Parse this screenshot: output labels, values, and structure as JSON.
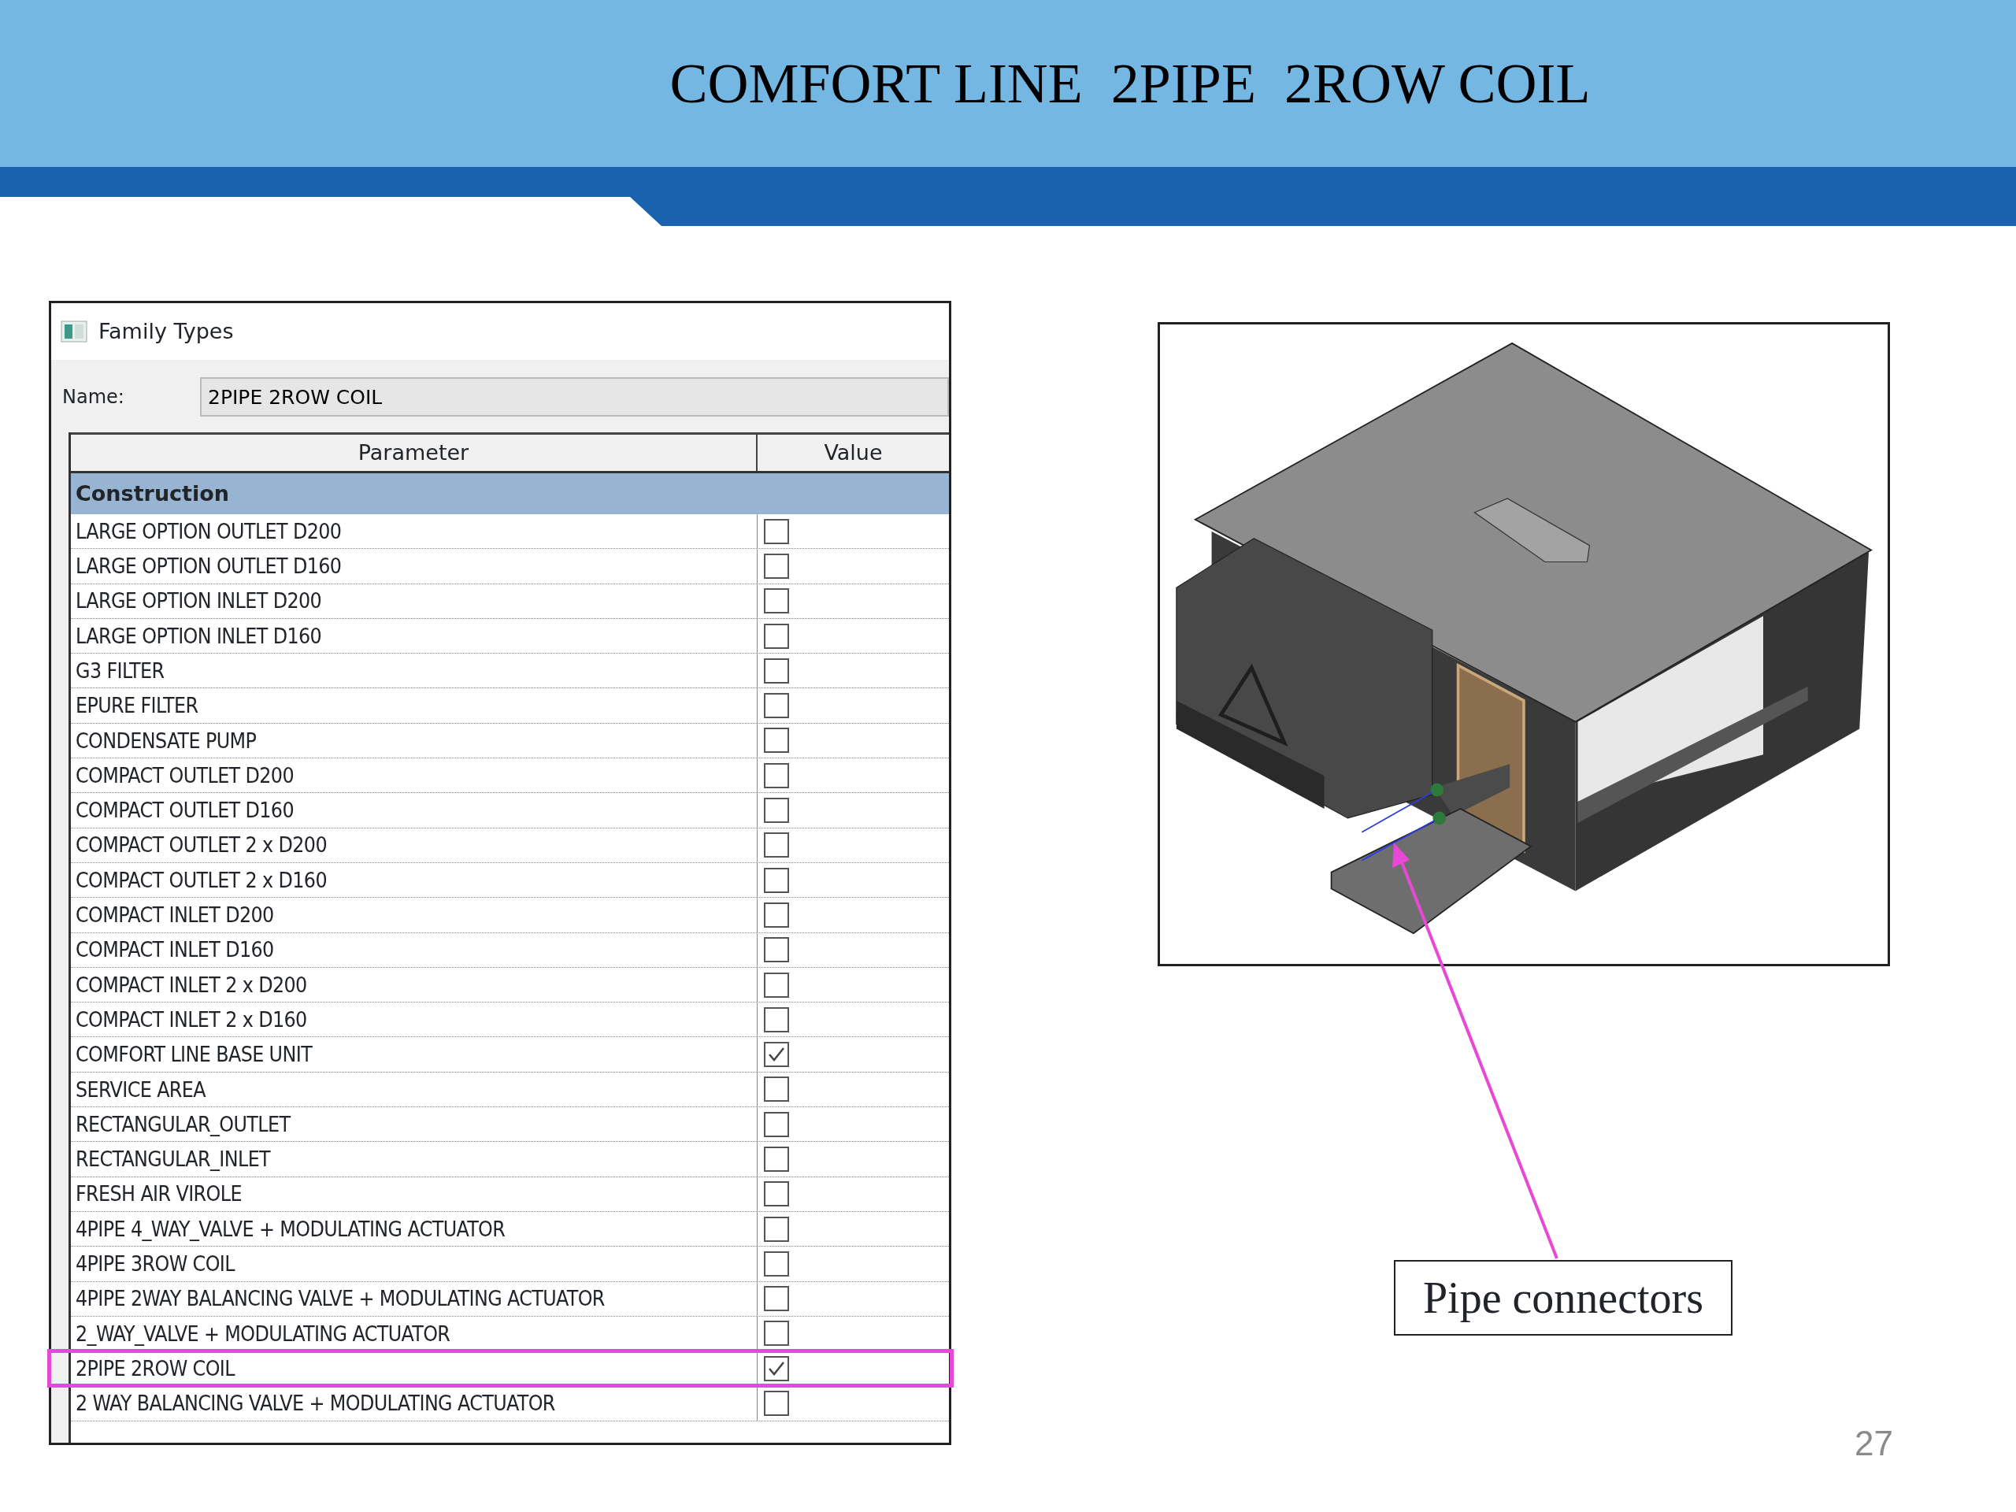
{
  "slide": {
    "title": "COMFORT LINE  2PIPE  2ROW COIL",
    "page_number": "27"
  },
  "dialog": {
    "title": "Family Types",
    "name_label": "Name:",
    "name_value": "2PIPE 2ROW COIL",
    "table": {
      "columns": [
        "Parameter",
        "Value"
      ],
      "group": "Construction",
      "rows": [
        {
          "label": "LARGE OPTION OUTLET D200",
          "checked": false,
          "highlighted": false
        },
        {
          "label": "LARGE OPTION OUTLET D160",
          "checked": false,
          "highlighted": false
        },
        {
          "label": "LARGE OPTION INLET D200",
          "checked": false,
          "highlighted": false
        },
        {
          "label": "LARGE OPTION INLET D160",
          "checked": false,
          "highlighted": false
        },
        {
          "label": "G3 FILTER",
          "checked": false,
          "highlighted": false
        },
        {
          "label": "EPURE FILTER",
          "checked": false,
          "highlighted": false
        },
        {
          "label": "CONDENSATE PUMP",
          "checked": false,
          "highlighted": false
        },
        {
          "label": "COMPACT OUTLET D200",
          "checked": false,
          "highlighted": false
        },
        {
          "label": "COMPACT OUTLET D160",
          "checked": false,
          "highlighted": false
        },
        {
          "label": "COMPACT OUTLET 2 x D200",
          "checked": false,
          "highlighted": false
        },
        {
          "label": "COMPACT OUTLET 2 x D160",
          "checked": false,
          "highlighted": false
        },
        {
          "label": "COMPACT INLET D200",
          "checked": false,
          "highlighted": false
        },
        {
          "label": "COMPACT INLET D160",
          "checked": false,
          "highlighted": false
        },
        {
          "label": "COMPACT INLET 2 x D200",
          "checked": false,
          "highlighted": false
        },
        {
          "label": "COMPACT INLET 2 x D160",
          "checked": false,
          "highlighted": false
        },
        {
          "label": "COMFORT LINE BASE UNIT",
          "checked": true,
          "highlighted": false
        },
        {
          "label": "SERVICE AREA",
          "checked": false,
          "highlighted": false
        },
        {
          "label": "RECTANGULAR_OUTLET",
          "checked": false,
          "highlighted": false
        },
        {
          "label": "RECTANGULAR_INLET",
          "checked": false,
          "highlighted": false
        },
        {
          "label": "FRESH AIR VIROLE",
          "checked": false,
          "highlighted": false
        },
        {
          "label": "4PIPE 4_WAY_VALVE + MODULATING ACTUATOR",
          "checked": false,
          "highlighted": false
        },
        {
          "label": "4PIPE 3ROW  COIL",
          "checked": false,
          "highlighted": false
        },
        {
          "label": "4PIPE 2WAY BALANCING VALVE + MODULATING ACTUATOR",
          "checked": false,
          "highlighted": false
        },
        {
          "label": "2_WAY_VALVE + MODULATING ACTUATOR",
          "checked": false,
          "highlighted": false
        },
        {
          "label": "2PIPE 2ROW COIL",
          "checked": true,
          "highlighted": true
        },
        {
          "label": "2 WAY BALANCING VALVE + MODULATING ACTUATOR",
          "checked": false,
          "highlighted": false
        }
      ]
    }
  },
  "callout": {
    "label": "Pipe connectors"
  }
}
